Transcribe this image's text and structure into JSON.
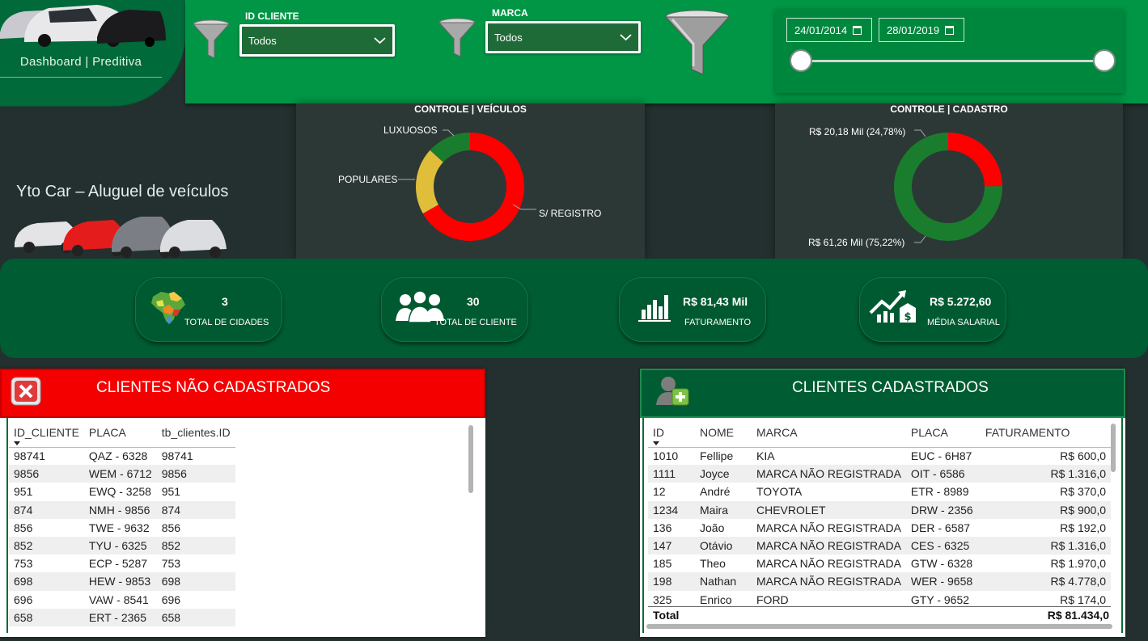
{
  "header": {
    "nav_title": "Dashboard | Preditiva",
    "filters": {
      "id_cliente": {
        "label": "ID CLIENTE",
        "value": "Todos"
      },
      "marca": {
        "label": "MARCA",
        "value": "Todos"
      }
    },
    "date_range": {
      "start": "24/01/2014",
      "end": "28/01/2019"
    }
  },
  "brand": {
    "name": "Yto Car – Aluguel de veículos"
  },
  "charts": {
    "veiculos": {
      "title": "CONTROLE | VEÍCULOS",
      "labels": {
        "luxuosos": "LUXUOSOS",
        "populares": "POPULARES",
        "sem_registro": "S/ REGISTRO"
      }
    },
    "cadastro": {
      "title": "CONTROLE | CADASTRO",
      "labels": {
        "red": "R$ 20,18 Mil (24,78%)",
        "green": "R$ 61,26 Mil (75,22%)"
      }
    }
  },
  "chart_data": [
    {
      "type": "pie",
      "title": "CONTROLE | VEÍCULOS",
      "categories": [
        "S/ REGISTRO",
        "POPULARES",
        "LUXUOSOS"
      ],
      "values": [
        0.667,
        0.2,
        0.133
      ],
      "colors": [
        "#ff0000",
        "#e0be3a",
        "#1a7d2e"
      ]
    },
    {
      "type": "pie",
      "title": "CONTROLE | CADASTRO",
      "categories": [
        "R$ 20,18 Mil (24,78%)",
        "R$ 61,26 Mil (75,22%)"
      ],
      "values": [
        24.78,
        75.22
      ],
      "colors": [
        "#ff0000",
        "#1a7d2e"
      ]
    }
  ],
  "kpis": {
    "cidades": {
      "value": "3",
      "label": "TOTAL DE CIDADES"
    },
    "clientes": {
      "value": "30",
      "label": "TOTAL DE CLIENTE"
    },
    "faturamento": {
      "value": "R$ 81,43 Mil",
      "label": "FATURAMENTO"
    },
    "media": {
      "value": "R$ 5.272,60",
      "label": "MÉDIA SALARIAL"
    }
  },
  "nao_cadastrados": {
    "title": "CLIENTES NÃO CADASTRADOS",
    "columns": [
      "ID_CLIENTE",
      "PLACA",
      "tb_clientes.ID"
    ],
    "rows": [
      [
        "98741",
        "QAZ - 6328",
        "98741"
      ],
      [
        "9856",
        "WEM - 6712",
        "9856"
      ],
      [
        "951",
        "EWQ - 3258",
        "951"
      ],
      [
        "874",
        "NMH - 9856",
        "874"
      ],
      [
        "856",
        "TWE - 9632",
        "856"
      ],
      [
        "852",
        "TYU - 6325",
        "852"
      ],
      [
        "753",
        "ECP - 5287",
        "753"
      ],
      [
        "698",
        "HEW - 9853",
        "698"
      ],
      [
        "696",
        "VAW - 8541",
        "696"
      ],
      [
        "658",
        "ERT - 2365",
        "658"
      ]
    ]
  },
  "cadastrados": {
    "title": "CLIENTES CADASTRADOS",
    "columns": [
      "ID",
      "NOME",
      "MARCA",
      "PLACA",
      "FATURAMENTO"
    ],
    "rows": [
      [
        "1010",
        "Fellipe",
        "KIA",
        "EUC - 6H87",
        "R$ 600,0"
      ],
      [
        "1111",
        "Joyce",
        "MARCA NÃO REGISTRADA",
        "OIT - 6586",
        "R$ 1.316,0"
      ],
      [
        "12",
        "André",
        "TOYOTA",
        "ETR - 8989",
        "R$ 370,0"
      ],
      [
        "1234",
        "Maira",
        "CHEVROLET",
        "DRW - 2356",
        "R$ 900,0"
      ],
      [
        "136",
        "João",
        "MARCA NÃO REGISTRADA",
        "DER - 6587",
        "R$ 192,0"
      ],
      [
        "147",
        "Otávio",
        "MARCA NÃO REGISTRADA",
        "CES - 6325",
        "R$ 1.316,0"
      ],
      [
        "185",
        "Theo",
        "MARCA NÃO REGISTRADA",
        "GTW - 6328",
        "R$ 1.970,0"
      ],
      [
        "198",
        "Nathan",
        "MARCA NÃO REGISTRADA",
        "WER - 9658",
        "R$ 4.778,0"
      ],
      [
        "325",
        "Enrico",
        "FORD",
        "GTY - 9652",
        "R$ 174,0"
      ]
    ],
    "total_label": "Total",
    "total_value": "R$ 81.434,0"
  }
}
